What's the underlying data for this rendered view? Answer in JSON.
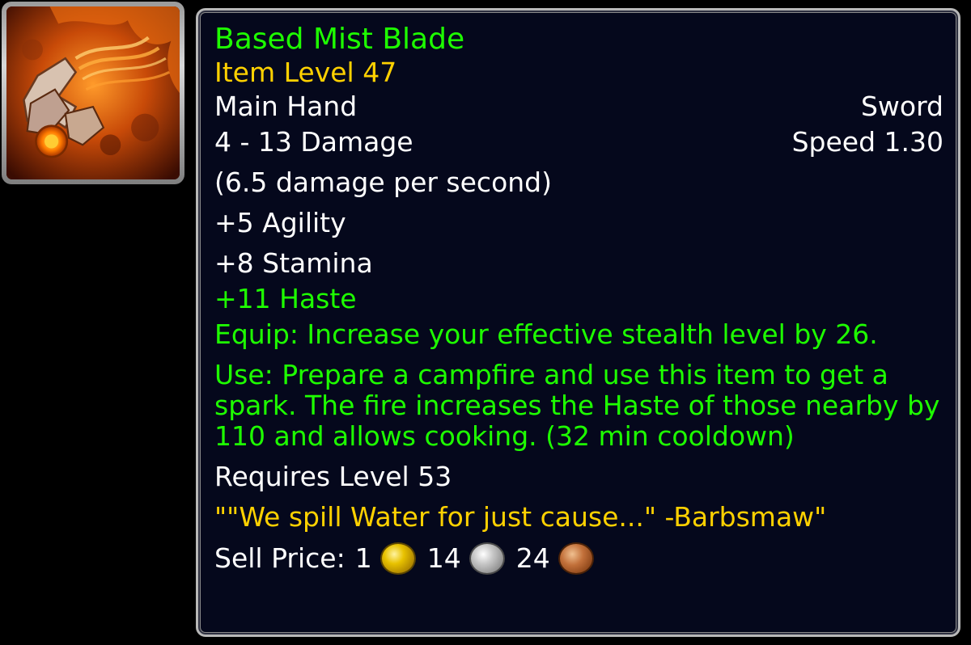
{
  "item": {
    "icon": "flaming-sword-icon",
    "name": "Based Mist Blade",
    "item_level": "Item Level 47",
    "slot": "Main Hand",
    "type": "Sword",
    "damage": "4 - 13 Damage",
    "speed": "Speed 1.30",
    "dps": "(6.5 damage per second)",
    "stats": {
      "agility": "+5 Agility",
      "stamina": "+8 Stamina",
      "haste": "+11 Haste"
    },
    "equip": "Equip: Increase your effective stealth level by 26.",
    "use": "Use: Prepare a campfire and use this item to get a spark. The fire increases the Haste of those nearby by 110 and allows cooking. (32 min cooldown)",
    "requires": "Requires Level 53",
    "flavor": "\"\"We spill Water for just cause...\" -Barbsmaw\"",
    "sell_price": {
      "label": "Sell Price:",
      "gold": "1",
      "silver": "14",
      "copper": "24"
    }
  },
  "colors": {
    "name": "#1eff00",
    "item_level": "#ffd100",
    "green_text": "#1eff00",
    "flavor": "#ffd100",
    "body_text": "#ffffff",
    "panel_bg": "#05081c"
  }
}
